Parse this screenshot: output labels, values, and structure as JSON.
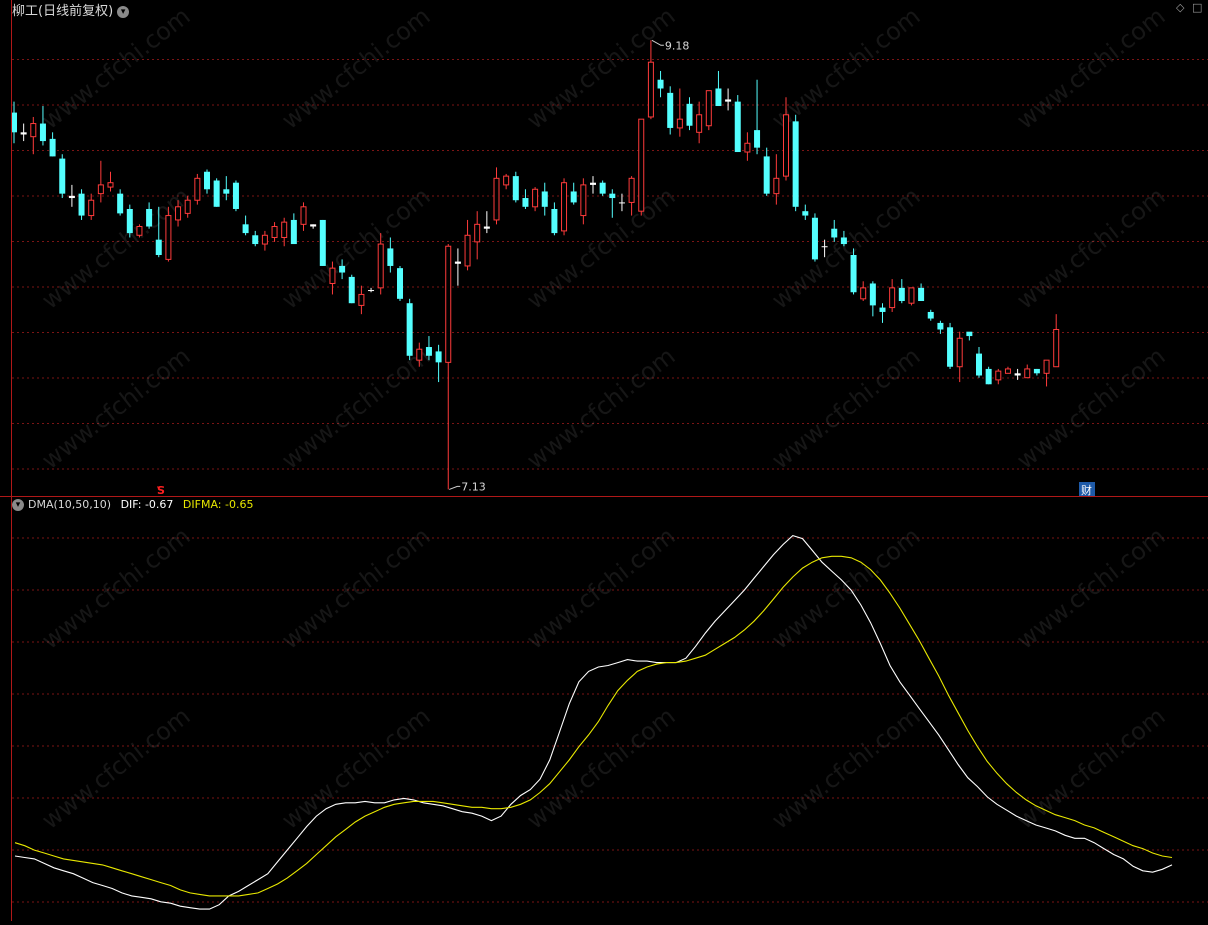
{
  "header": {
    "title": "柳工(日线前复权)",
    "indicator_name": "DMA(10,50,10)",
    "dif_label": "DIF: -0.67",
    "difma_label": "DIFMA: -0.65",
    "corner_icons": [
      "diamond-icon",
      "square-icon"
    ]
  },
  "markers": {
    "high_label": "9.18",
    "low_label": "7.13",
    "signal_label": "S",
    "finance_label": "财"
  },
  "watermark_text": "www.cfchi.com",
  "colors": {
    "up": "#ff3b3b",
    "down": "#54ffff",
    "doji": "#ffffff",
    "grid": "#7a1515",
    "frame": "#b01818",
    "dif": "#ffffff",
    "difma": "#e8e800",
    "signal": "#ff2020",
    "finance_badge": "#1e5aa8"
  },
  "chart_data": [
    {
      "type": "candlestick",
      "title": "柳工(日线前复权)",
      "y_extremes": {
        "high": 9.18,
        "low": 7.13
      },
      "ylim": [
        7.1,
        9.3
      ],
      "grid": true,
      "candles": [
        {
          "o": 8.85,
          "h": 8.9,
          "l": 8.71,
          "c": 8.76
        },
        {
          "o": 8.76,
          "h": 8.8,
          "l": 8.72,
          "c": 8.75
        },
        {
          "o": 8.74,
          "h": 8.83,
          "l": 8.66,
          "c": 8.8
        },
        {
          "o": 8.8,
          "h": 8.88,
          "l": 8.7,
          "c": 8.72
        },
        {
          "o": 8.73,
          "h": 8.76,
          "l": 8.65,
          "c": 8.65
        },
        {
          "o": 8.64,
          "h": 8.66,
          "l": 8.46,
          "c": 8.48
        },
        {
          "o": 8.47,
          "h": 8.52,
          "l": 8.42,
          "c": 8.46
        },
        {
          "o": 8.48,
          "h": 8.5,
          "l": 8.36,
          "c": 8.38
        },
        {
          "o": 8.38,
          "h": 8.48,
          "l": 8.36,
          "c": 8.45
        },
        {
          "o": 8.48,
          "h": 8.63,
          "l": 8.44,
          "c": 8.52
        },
        {
          "o": 8.51,
          "h": 8.58,
          "l": 8.49,
          "c": 8.53
        },
        {
          "o": 8.48,
          "h": 8.5,
          "l": 8.38,
          "c": 8.39
        },
        {
          "o": 8.41,
          "h": 8.43,
          "l": 8.28,
          "c": 8.3
        },
        {
          "o": 8.29,
          "h": 8.34,
          "l": 8.28,
          "c": 8.33
        },
        {
          "o": 8.41,
          "h": 8.44,
          "l": 8.32,
          "c": 8.33
        },
        {
          "o": 8.27,
          "h": 8.42,
          "l": 8.19,
          "c": 8.2
        },
        {
          "o": 8.18,
          "h": 8.42,
          "l": 8.17,
          "c": 8.38
        },
        {
          "o": 8.36,
          "h": 8.45,
          "l": 8.33,
          "c": 8.42
        },
        {
          "o": 8.39,
          "h": 8.47,
          "l": 8.37,
          "c": 8.45
        },
        {
          "o": 8.45,
          "h": 8.57,
          "l": 8.43,
          "c": 8.55
        },
        {
          "o": 8.58,
          "h": 8.59,
          "l": 8.48,
          "c": 8.5
        },
        {
          "o": 8.54,
          "h": 8.55,
          "l": 8.42,
          "c": 8.42
        },
        {
          "o": 8.5,
          "h": 8.56,
          "l": 8.45,
          "c": 8.48
        },
        {
          "o": 8.53,
          "h": 8.54,
          "l": 8.4,
          "c": 8.41
        },
        {
          "o": 8.34,
          "h": 8.38,
          "l": 8.29,
          "c": 8.3
        },
        {
          "o": 8.29,
          "h": 8.31,
          "l": 8.24,
          "c": 8.25
        },
        {
          "o": 8.25,
          "h": 8.31,
          "l": 8.22,
          "c": 8.29
        },
        {
          "o": 8.28,
          "h": 8.35,
          "l": 8.26,
          "c": 8.33
        },
        {
          "o": 8.28,
          "h": 8.37,
          "l": 8.24,
          "c": 8.35
        },
        {
          "o": 8.36,
          "h": 8.39,
          "l": 8.25,
          "c": 8.25
        },
        {
          "o": 8.34,
          "h": 8.44,
          "l": 8.31,
          "c": 8.42
        },
        {
          "o": 8.34,
          "h": 8.34,
          "l": 8.32,
          "c": 8.33
        },
        {
          "o": 8.36,
          "h": 8.36,
          "l": 8.15,
          "c": 8.15
        },
        {
          "o": 8.07,
          "h": 8.17,
          "l": 8.02,
          "c": 8.14
        },
        {
          "o": 8.15,
          "h": 8.18,
          "l": 8.09,
          "c": 8.12
        },
        {
          "o": 8.1,
          "h": 8.11,
          "l": 7.98,
          "c": 7.98
        },
        {
          "o": 7.97,
          "h": 8.06,
          "l": 7.93,
          "c": 8.02
        },
        {
          "o": 8.04,
          "h": 8.05,
          "l": 8.03,
          "c": 8.04
        },
        {
          "o": 8.05,
          "h": 8.3,
          "l": 8.02,
          "c": 8.25
        },
        {
          "o": 8.23,
          "h": 8.28,
          "l": 8.12,
          "c": 8.15
        },
        {
          "o": 8.14,
          "h": 8.15,
          "l": 7.99,
          "c": 8.0
        },
        {
          "o": 7.98,
          "h": 8.0,
          "l": 7.72,
          "c": 7.74
        },
        {
          "o": 7.72,
          "h": 7.8,
          "l": 7.69,
          "c": 7.77
        },
        {
          "o": 7.78,
          "h": 7.83,
          "l": 7.72,
          "c": 7.74
        },
        {
          "o": 7.76,
          "h": 7.79,
          "l": 7.62,
          "c": 7.71
        },
        {
          "o": 7.71,
          "h": 8.25,
          "l": 7.13,
          "c": 8.24
        },
        {
          "o": 8.16,
          "h": 8.23,
          "l": 8.06,
          "c": 8.17
        },
        {
          "o": 8.15,
          "h": 8.36,
          "l": 8.13,
          "c": 8.29
        },
        {
          "o": 8.26,
          "h": 8.4,
          "l": 8.18,
          "c": 8.34
        },
        {
          "o": 8.33,
          "h": 8.4,
          "l": 8.3,
          "c": 8.32
        },
        {
          "o": 8.36,
          "h": 8.6,
          "l": 8.34,
          "c": 8.55
        },
        {
          "o": 8.52,
          "h": 8.57,
          "l": 8.5,
          "c": 8.56
        },
        {
          "o": 8.56,
          "h": 8.58,
          "l": 8.44,
          "c": 8.45
        },
        {
          "o": 8.46,
          "h": 8.5,
          "l": 8.41,
          "c": 8.42
        },
        {
          "o": 8.42,
          "h": 8.51,
          "l": 8.4,
          "c": 8.5
        },
        {
          "o": 8.49,
          "h": 8.53,
          "l": 8.38,
          "c": 8.42
        },
        {
          "o": 8.41,
          "h": 8.44,
          "l": 8.29,
          "c": 8.3
        },
        {
          "o": 8.31,
          "h": 8.55,
          "l": 8.29,
          "c": 8.53
        },
        {
          "o": 8.49,
          "h": 8.53,
          "l": 8.43,
          "c": 8.44
        },
        {
          "o": 8.38,
          "h": 8.55,
          "l": 8.34,
          "c": 8.52
        },
        {
          "o": 8.52,
          "h": 8.56,
          "l": 8.48,
          "c": 8.53
        },
        {
          "o": 8.53,
          "h": 8.54,
          "l": 8.47,
          "c": 8.48
        },
        {
          "o": 8.48,
          "h": 8.5,
          "l": 8.37,
          "c": 8.46
        },
        {
          "o": 8.44,
          "h": 8.48,
          "l": 8.4,
          "c": 8.44
        },
        {
          "o": 8.44,
          "h": 8.56,
          "l": 8.38,
          "c": 8.55
        },
        {
          "o": 8.4,
          "h": 8.82,
          "l": 8.38,
          "c": 8.82
        },
        {
          "o": 8.83,
          "h": 9.18,
          "l": 8.82,
          "c": 9.08
        },
        {
          "o": 9.0,
          "h": 9.04,
          "l": 8.92,
          "c": 8.96
        },
        {
          "o": 8.94,
          "h": 8.97,
          "l": 8.75,
          "c": 8.78
        },
        {
          "o": 8.78,
          "h": 8.96,
          "l": 8.74,
          "c": 8.82
        },
        {
          "o": 8.89,
          "h": 8.92,
          "l": 8.77,
          "c": 8.79
        },
        {
          "o": 8.76,
          "h": 8.9,
          "l": 8.71,
          "c": 8.84
        },
        {
          "o": 8.79,
          "h": 8.93,
          "l": 8.77,
          "c": 8.95
        },
        {
          "o": 8.96,
          "h": 9.04,
          "l": 8.88,
          "c": 8.88
        },
        {
          "o": 8.91,
          "h": 8.96,
          "l": 8.86,
          "c": 8.9
        },
        {
          "o": 8.9,
          "h": 8.93,
          "l": 8.67,
          "c": 8.67
        },
        {
          "o": 8.67,
          "h": 8.76,
          "l": 8.63,
          "c": 8.71
        },
        {
          "o": 8.77,
          "h": 9.0,
          "l": 8.66,
          "c": 8.69
        },
        {
          "o": 8.65,
          "h": 8.69,
          "l": 8.47,
          "c": 8.48
        },
        {
          "o": 8.48,
          "h": 8.66,
          "l": 8.43,
          "c": 8.55
        },
        {
          "o": 8.56,
          "h": 8.92,
          "l": 8.54,
          "c": 8.84
        },
        {
          "o": 8.81,
          "h": 8.84,
          "l": 8.4,
          "c": 8.42
        },
        {
          "o": 8.4,
          "h": 8.43,
          "l": 8.36,
          "c": 8.38
        },
        {
          "o": 8.37,
          "h": 8.39,
          "l": 8.17,
          "c": 8.18
        },
        {
          "o": 8.24,
          "h": 8.27,
          "l": 8.19,
          "c": 8.24
        },
        {
          "o": 8.32,
          "h": 8.36,
          "l": 8.26,
          "c": 8.28
        },
        {
          "o": 8.28,
          "h": 8.31,
          "l": 8.24,
          "c": 8.25
        },
        {
          "o": 8.2,
          "h": 8.23,
          "l": 8.02,
          "c": 8.03
        },
        {
          "o": 8.0,
          "h": 8.08,
          "l": 7.99,
          "c": 8.05
        },
        {
          "o": 8.07,
          "h": 8.08,
          "l": 7.92,
          "c": 7.97
        },
        {
          "o": 7.96,
          "h": 7.98,
          "l": 7.89,
          "c": 7.94
        },
        {
          "o": 7.96,
          "h": 8.09,
          "l": 7.94,
          "c": 8.05
        },
        {
          "o": 8.05,
          "h": 8.09,
          "l": 7.98,
          "c": 7.99
        },
        {
          "o": 7.98,
          "h": 8.05,
          "l": 7.97,
          "c": 8.05
        },
        {
          "o": 8.05,
          "h": 8.07,
          "l": 7.99,
          "c": 7.99
        },
        {
          "o": 7.94,
          "h": 7.95,
          "l": 7.9,
          "c": 7.91
        },
        {
          "o": 7.89,
          "h": 7.9,
          "l": 7.84,
          "c": 7.86
        },
        {
          "o": 7.87,
          "h": 7.89,
          "l": 7.68,
          "c": 7.69
        },
        {
          "o": 7.69,
          "h": 7.85,
          "l": 7.62,
          "c": 7.82
        },
        {
          "o": 7.85,
          "h": 7.84,
          "l": 7.81,
          "c": 7.83
        },
        {
          "o": 7.75,
          "h": 7.78,
          "l": 7.64,
          "c": 7.65
        },
        {
          "o": 7.68,
          "h": 7.69,
          "l": 7.61,
          "c": 7.61
        },
        {
          "o": 7.63,
          "h": 7.68,
          "l": 7.61,
          "c": 7.67
        },
        {
          "o": 7.66,
          "h": 7.69,
          "l": 7.66,
          "c": 7.68
        },
        {
          "o": 7.65,
          "h": 7.68,
          "l": 7.63,
          "c": 7.66
        },
        {
          "o": 7.64,
          "h": 7.7,
          "l": 7.64,
          "c": 7.68
        },
        {
          "o": 7.68,
          "h": 7.68,
          "l": 7.65,
          "c": 7.66
        },
        {
          "o": 7.66,
          "h": 7.72,
          "l": 7.6,
          "c": 7.72
        },
        {
          "o": 7.69,
          "h": 7.93,
          "l": 7.69,
          "c": 7.86
        }
      ]
    },
    {
      "type": "line",
      "title": "DMA(10,50,10)",
      "ylim": [
        -1.4,
        1.35
      ],
      "grid": true,
      "series": [
        {
          "name": "DIF",
          "values": [
            -0.98,
            -0.99,
            -1.0,
            -1.03,
            -1.06,
            -1.08,
            -1.1,
            -1.13,
            -1.16,
            -1.18,
            -1.2,
            -1.23,
            -1.25,
            -1.26,
            -1.27,
            -1.29,
            -1.3,
            -1.32,
            -1.33,
            -1.34,
            -1.34,
            -1.31,
            -1.25,
            -1.22,
            -1.18,
            -1.14,
            -1.1,
            -1.02,
            -0.94,
            -0.86,
            -0.78,
            -0.71,
            -0.66,
            -0.63,
            -0.62,
            -0.62,
            -0.61,
            -0.62,
            -0.62,
            -0.6,
            -0.59,
            -0.6,
            -0.62,
            -0.63,
            -0.64,
            -0.66,
            -0.68,
            -0.69,
            -0.71,
            -0.74,
            -0.71,
            -0.63,
            -0.57,
            -0.53,
            -0.46,
            -0.33,
            -0.14,
            0.05,
            0.2,
            0.27,
            0.3,
            0.31,
            0.33,
            0.35,
            0.34,
            0.34,
            0.33,
            0.33,
            0.33,
            0.36,
            0.44,
            0.53,
            0.61,
            0.68,
            0.75,
            0.82,
            0.9,
            0.98,
            1.06,
            1.13,
            1.19,
            1.17,
            1.09,
            1.01,
            0.95,
            0.89,
            0.82,
            0.72,
            0.6,
            0.46,
            0.31,
            0.2,
            0.11,
            0.02,
            -0.07,
            -0.16,
            -0.26,
            -0.36,
            -0.45,
            -0.51,
            -0.58,
            -0.63,
            -0.67,
            -0.71,
            -0.74,
            -0.77,
            -0.79,
            -0.81,
            -0.84,
            -0.86,
            -0.86,
            -0.89,
            -0.93,
            -0.97,
            -1.0,
            -1.05,
            -1.08,
            -1.09,
            -1.07,
            -1.04
          ]
        },
        {
          "name": "DIFMA",
          "values": [
            -0.89,
            -0.91,
            -0.94,
            -0.96,
            -0.98,
            -1.0,
            -1.01,
            -1.02,
            -1.03,
            -1.04,
            -1.06,
            -1.08,
            -1.1,
            -1.12,
            -1.14,
            -1.16,
            -1.18,
            -1.21,
            -1.23,
            -1.24,
            -1.25,
            -1.25,
            -1.25,
            -1.25,
            -1.24,
            -1.23,
            -1.2,
            -1.17,
            -1.13,
            -1.08,
            -1.03,
            -0.97,
            -0.91,
            -0.85,
            -0.8,
            -0.75,
            -0.71,
            -0.68,
            -0.65,
            -0.63,
            -0.62,
            -0.61,
            -0.61,
            -0.61,
            -0.62,
            -0.63,
            -0.64,
            -0.65,
            -0.65,
            -0.66,
            -0.66,
            -0.65,
            -0.63,
            -0.6,
            -0.55,
            -0.49,
            -0.41,
            -0.33,
            -0.24,
            -0.16,
            -0.07,
            0.04,
            0.14,
            0.21,
            0.27,
            0.3,
            0.32,
            0.33,
            0.33,
            0.34,
            0.36,
            0.38,
            0.42,
            0.46,
            0.5,
            0.55,
            0.61,
            0.68,
            0.76,
            0.84,
            0.91,
            0.97,
            1.01,
            1.04,
            1.05,
            1.05,
            1.04,
            1.01,
            0.96,
            0.89,
            0.8,
            0.7,
            0.59,
            0.48,
            0.36,
            0.24,
            0.11,
            -0.01,
            -0.13,
            -0.24,
            -0.34,
            -0.42,
            -0.49,
            -0.55,
            -0.6,
            -0.64,
            -0.67,
            -0.7,
            -0.72,
            -0.74,
            -0.77,
            -0.79,
            -0.82,
            -0.85,
            -0.88,
            -0.91,
            -0.93,
            -0.96,
            -0.98,
            -0.99
          ]
        }
      ]
    }
  ]
}
